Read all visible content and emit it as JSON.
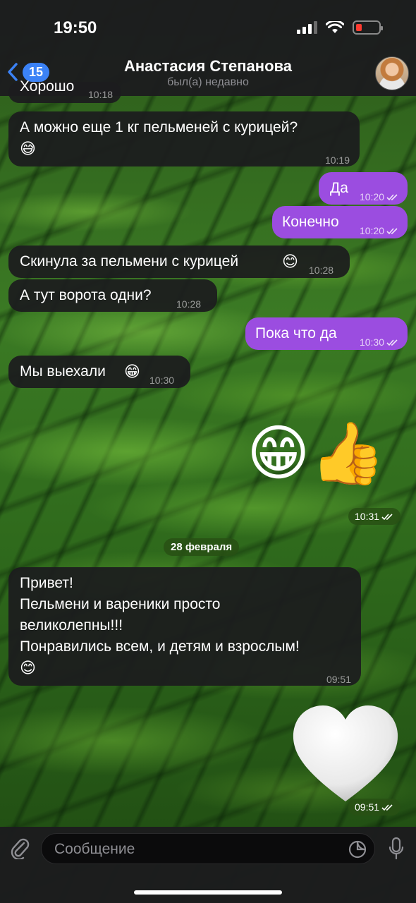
{
  "status": {
    "time": "19:50"
  },
  "header": {
    "back_count": "15",
    "title": "Анастасия Степанова",
    "subtitle": "был(а) недавно"
  },
  "messages": [
    {
      "dir": "in",
      "text": "Хорошо",
      "time": "10:18"
    },
    {
      "dir": "in",
      "text": "А можно еще 1 кг пельменей с курицей?",
      "emoji": "😅",
      "time": "10:19"
    },
    {
      "dir": "out",
      "text": "Да",
      "time": "10:20"
    },
    {
      "dir": "out",
      "text": "Конечно",
      "time": "10:20"
    },
    {
      "dir": "in",
      "text": "Скинула за пельмени с курицей",
      "emoji": "😊",
      "time": "10:28"
    },
    {
      "dir": "in",
      "text": "А тут ворота одни?",
      "time": "10:28"
    },
    {
      "dir": "out",
      "text": "Пока что да",
      "time": "10:30"
    },
    {
      "dir": "in",
      "text": "Мы выехали",
      "emoji": "😁",
      "time": "10:30"
    },
    {
      "dir": "out",
      "emoji_only": "😁👍",
      "time": "10:31"
    },
    {
      "dir": "in",
      "lines": [
        "Привет!",
        "Пельмени и вареники просто",
        "великолепны!!!",
        "Понравились всем, и детям и взрослым!"
      ],
      "emoji": "😊",
      "time": "09:51"
    },
    {
      "dir": "out",
      "emoji_only": "🤍",
      "time": "09:51"
    }
  ],
  "date_separator": "28 февраля",
  "input": {
    "placeholder": "Сообщение"
  },
  "colors": {
    "outgoing": "#9b4de0",
    "incoming": "#1c1c1e",
    "badge": "#3b82f6"
  }
}
